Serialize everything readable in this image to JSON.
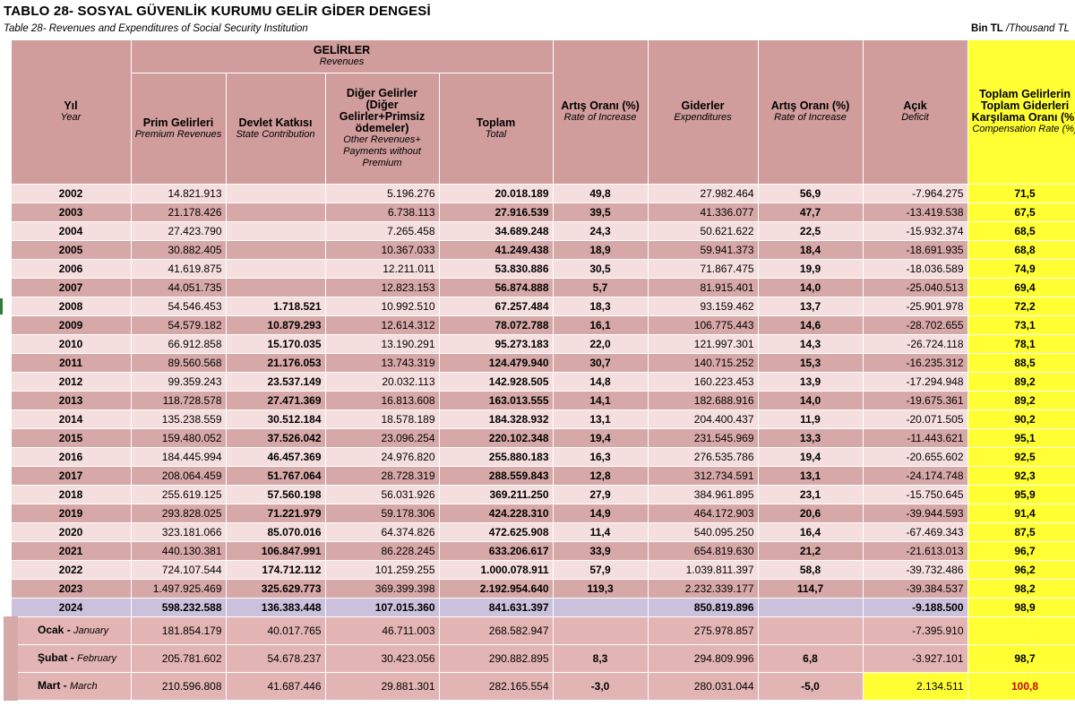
{
  "header": {
    "title": "TABLO 28- SOSYAL GÜVENLİK KURUMU GELİR GİDER DENGESİ",
    "subtitle": "Table 28- Revenues and Expenditures  of Social Security Institution",
    "unit_tr": "Bin TL",
    "unit_en": "/Thousand TL"
  },
  "columns": {
    "year": {
      "tr": "Yıl",
      "en": "Year"
    },
    "revenues_group": {
      "tr": "GELİRLER",
      "en": "Revenues"
    },
    "premium": {
      "tr": "Prim Gelirleri",
      "en": "Premium Revenues"
    },
    "state": {
      "tr": "Devlet Katkısı",
      "en": "State Contribution"
    },
    "other": {
      "tr": "Diğer Gelirler (Diğer Gelirler+Primsiz ödemeler)",
      "en": "Other Revenues+ Payments without Premium"
    },
    "total": {
      "tr": "Toplam",
      "en": "Total"
    },
    "increase1": {
      "tr": "Artış Oranı (%)",
      "en": "Rate of Increase"
    },
    "expenditures": {
      "tr": "Giderler",
      "en": "Expenditures"
    },
    "increase2": {
      "tr": "Artış Oranı (%)",
      "en": "Rate of Increase"
    },
    "deficit": {
      "tr": "Açık",
      "en": "Deficit"
    },
    "compensation": {
      "tr": "Toplam Gelirlerin Toplam Giderleri Karşılama Oranı (%)",
      "en": "Compensation Rate (%)"
    }
  },
  "rows": [
    {
      "year": "2002",
      "premium": "14.821.913",
      "state": "",
      "other": "5.196.276",
      "total": "20.018.189",
      "inc1": "49,8",
      "exp": "27.982.464",
      "inc2": "56,9",
      "deficit": "-7.964.275",
      "comp": "71,5"
    },
    {
      "year": "2003",
      "premium": "21.178.426",
      "state": "",
      "other": "6.738.113",
      "total": "27.916.539",
      "inc1": "39,5",
      "exp": "41.336.077",
      "inc2": "47,7",
      "deficit": "-13.419.538",
      "comp": "67,5"
    },
    {
      "year": "2004",
      "premium": "27.423.790",
      "state": "",
      "other": "7.265.458",
      "total": "34.689.248",
      "inc1": "24,3",
      "exp": "50.621.622",
      "inc2": "22,5",
      "deficit": "-15.932.374",
      "comp": "68,5"
    },
    {
      "year": "2005",
      "premium": "30.882.405",
      "state": "",
      "other": "10.367.033",
      "total": "41.249.438",
      "inc1": "18,9",
      "exp": "59.941.373",
      "inc2": "18,4",
      "deficit": "-18.691.935",
      "comp": "68,8"
    },
    {
      "year": "2006",
      "premium": "41.619.875",
      "state": "",
      "other": "12.211.011",
      "total": "53.830.886",
      "inc1": "30,5",
      "exp": "71.867.475",
      "inc2": "19,9",
      "deficit": "-18.036.589",
      "comp": "74,9"
    },
    {
      "year": "2007",
      "premium": "44.051.735",
      "state": "",
      "other": "12.823.153",
      "total": "56.874.888",
      "inc1": "5,7",
      "exp": "81.915.401",
      "inc2": "14,0",
      "deficit": "-25.040.513",
      "comp": "69,4"
    },
    {
      "year": "2008",
      "premium": "54.546.453",
      "state": "1.718.521",
      "other": "10.992.510",
      "total": "67.257.484",
      "inc1": "18,3",
      "exp": "93.159.462",
      "inc2": "13,7",
      "deficit": "-25.901.978",
      "comp": "72,2"
    },
    {
      "year": "2009",
      "premium": "54.579.182",
      "state": "10.879.293",
      "other": "12.614.312",
      "total": "78.072.788",
      "inc1": "16,1",
      "exp": "106.775.443",
      "inc2": "14,6",
      "deficit": "-28.702.655",
      "comp": "73,1"
    },
    {
      "year": "2010",
      "premium": "66.912.858",
      "state": "15.170.035",
      "other": "13.190.291",
      "total": "95.273.183",
      "inc1": "22,0",
      "exp": "121.997.301",
      "inc2": "14,3",
      "deficit": "-26.724.118",
      "comp": "78,1"
    },
    {
      "year": "2011",
      "premium": "89.560.568",
      "state": "21.176.053",
      "other": "13.743.319",
      "total": "124.479.940",
      "inc1": "30,7",
      "exp": "140.715.252",
      "inc2": "15,3",
      "deficit": "-16.235.312",
      "comp": "88,5"
    },
    {
      "year": "2012",
      "premium": "99.359.243",
      "state": "23.537.149",
      "other": "20.032.113",
      "total": "142.928.505",
      "inc1": "14,8",
      "exp": "160.223.453",
      "inc2": "13,9",
      "deficit": "-17.294.948",
      "comp": "89,2"
    },
    {
      "year": "2013",
      "premium": "118.728.578",
      "state": "27.471.369",
      "other": "16.813.608",
      "total": "163.013.555",
      "inc1": "14,1",
      "exp": "182.688.916",
      "inc2": "14,0",
      "deficit": "-19.675.361",
      "comp": "89,2"
    },
    {
      "year": "2014",
      "premium": "135.238.559",
      "state": "30.512.184",
      "other": "18.578.189",
      "total": "184.328.932",
      "inc1": "13,1",
      "exp": "204.400.437",
      "inc2": "11,9",
      "deficit": "-20.071.505",
      "comp": "90,2"
    },
    {
      "year": "2015",
      "premium": "159.480.052",
      "state": "37.526.042",
      "other": "23.096.254",
      "total": "220.102.348",
      "inc1": "19,4",
      "exp": "231.545.969",
      "inc2": "13,3",
      "deficit": "-11.443.621",
      "comp": "95,1"
    },
    {
      "year": "2016",
      "premium": "184.445.994",
      "state": "46.457.369",
      "other": "24.976.820",
      "total": "255.880.183",
      "inc1": "16,3",
      "exp": "276.535.786",
      "inc2": "19,4",
      "deficit": "-20.655.602",
      "comp": "92,5"
    },
    {
      "year": "2017",
      "premium": "208.064.459",
      "state": "51.767.064",
      "other": "28.728.319",
      "total": "288.559.843",
      "inc1": "12,8",
      "exp": "312.734.591",
      "inc2": "13,1",
      "deficit": "-24.174.748",
      "comp": "92,3"
    },
    {
      "year": "2018",
      "premium": "255.619.125",
      "state": "57.560.198",
      "other": "56.031.926",
      "total": "369.211.250",
      "inc1": "27,9",
      "exp": "384.961.895",
      "inc2": "23,1",
      "deficit": "-15.750.645",
      "comp": "95,9"
    },
    {
      "year": "2019",
      "premium": "293.828.025",
      "state": "71.221.979",
      "other": "59.178.306",
      "total": "424.228.310",
      "inc1": "14,9",
      "exp": "464.172.903",
      "inc2": "20,6",
      "deficit": "-39.944.593",
      "comp": "91,4"
    },
    {
      "year": "2020",
      "premium": "323.181.066",
      "state": "85.070.016",
      "other": "64.374.826",
      "total": "472.625.908",
      "inc1": "11,4",
      "exp": "540.095.250",
      "inc2": "16,4",
      "deficit": "-67.469.343",
      "comp": "87,5"
    },
    {
      "year": "2021",
      "premium": "440.130.381",
      "state": "106.847.991",
      "other": "86.228.245",
      "total": "633.206.617",
      "inc1": "33,9",
      "exp": "654.819.630",
      "inc2": "21,2",
      "deficit": "-21.613.013",
      "comp": "96,7"
    },
    {
      "year": "2022",
      "premium": "724.107.544",
      "state": "174.712.112",
      "other": "101.259.255",
      "total": "1.000.078.911",
      "inc1": "57,9",
      "exp": "1.039.811.397",
      "inc2": "58,8",
      "deficit": "-39.732.486",
      "comp": "96,2"
    },
    {
      "year": "2023",
      "premium": "1.497.925.469",
      "state": "325.629.773",
      "other": "369.399.398",
      "total": "2.192.954.640",
      "inc1": "119,3",
      "exp": "2.232.339.177",
      "inc2": "114,7",
      "deficit": "-39.384.537",
      "comp": "98,2"
    }
  ],
  "row_2024": {
    "year": "2024",
    "premium": "598.232.588",
    "state": "136.383.448",
    "other": "107.015.360",
    "total": "841.631.397",
    "inc1": "",
    "exp": "850.819.896",
    "inc2": "",
    "deficit": "-9.188.500",
    "comp": "98,9"
  },
  "months": [
    {
      "tr": "Ocak -",
      "en": "January",
      "premium": "181.854.179",
      "state": "40.017.765",
      "other": "46.711.003",
      "total": "268.582.947",
      "inc1": "",
      "exp": "275.978.857",
      "inc2": "",
      "deficit": "-7.395.910",
      "comp": ""
    },
    {
      "tr": "Şubat -",
      "en": "February",
      "premium": "205.781.602",
      "state": "54.678.237",
      "other": "30.423.056",
      "total": "290.882.895",
      "inc1": "8,3",
      "exp": "294.809.996",
      "inc2": "6,8",
      "deficit": "-3.927.101",
      "comp": "98,7"
    },
    {
      "tr": "Mart -",
      "en": "March",
      "premium": "210.596.808",
      "state": "41.687.446",
      "other": "29.881.301",
      "total": "282.165.554",
      "inc1": "-3,0",
      "exp": "280.031.044",
      "inc2": "-5,0",
      "deficit": "2.134.511",
      "comp": "100,8"
    }
  ]
}
